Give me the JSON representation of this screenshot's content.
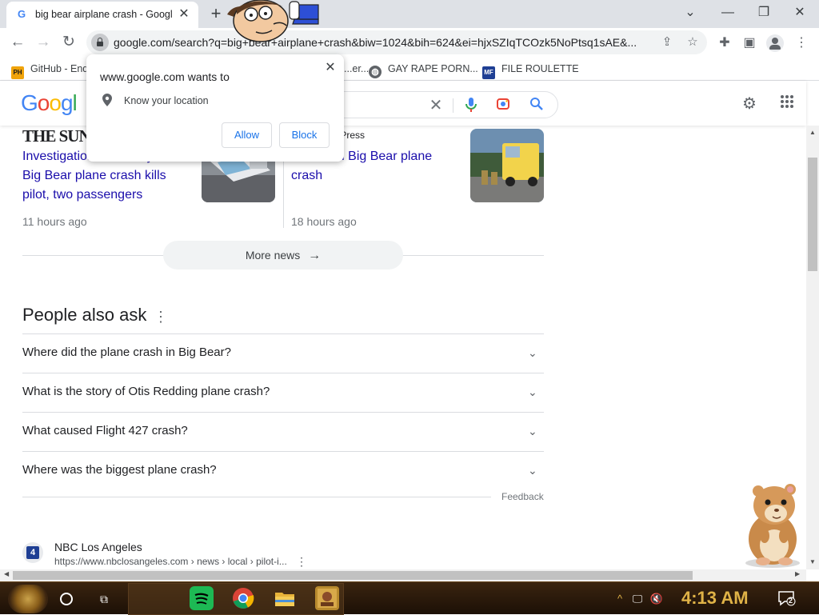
{
  "browser": {
    "tab_title": "big bear airplane crash - Googl",
    "tab_favicon": "G",
    "url_visible": "google.com/search?q=big+bear+airplane+crash&biw=1024&bih=624&ei=hjxSZIqTCOzk5NoPtsq1sAE&..."
  },
  "bookmarks": [
    {
      "label": "GitHub - End",
      "icon": "PH"
    },
    {
      "label": "...er...",
      "icon": ""
    },
    {
      "label": "GAY RAPE PORN...",
      "icon": "globe-icon"
    },
    {
      "label": "FILE ROULETTE",
      "icon": "MF"
    }
  ],
  "google": {
    "logo_text": "Google",
    "logo_visible": "Googl"
  },
  "permission_popup": {
    "title": "www.google.com wants to",
    "request": "Know your location",
    "allow_label": "Allow",
    "block_label": "Block"
  },
  "news": [
    {
      "publisher": "THE SUN",
      "title_line1": "Investigation underway after",
      "title_line2": "Big Bear plane crash kills",
      "title_line3": "pilot, two passengers",
      "time": "11 hours ago"
    },
    {
      "publisher": "...lle Daily Press",
      "title_line1": "3 killed in Big Bear plane",
      "title_line2": "crash",
      "time": "18 hours ago"
    }
  ],
  "more_news_label": "More news",
  "people_also_ask": {
    "title": "People also ask",
    "questions": [
      "Where did the plane crash in Big Bear?",
      "What is the story of Otis Redding plane crash?",
      "What caused Flight 427 crash?",
      "Where was the biggest plane crash?"
    ],
    "feedback_label": "Feedback"
  },
  "result": {
    "site": "NBC Los Angeles",
    "url": "https://www.nbclosangeles.com › news › local › pilot-i..."
  },
  "taskbar": {
    "clock": "4:13 AM",
    "notification_count": "2"
  },
  "colors": {
    "link": "#1a0dab",
    "google_blue": "#4285f4",
    "google_red": "#ea4335",
    "google_yellow": "#fbbc05",
    "google_green": "#34a853",
    "clock": "#e0b347",
    "taskbar_bg": "#2a1a0c"
  }
}
